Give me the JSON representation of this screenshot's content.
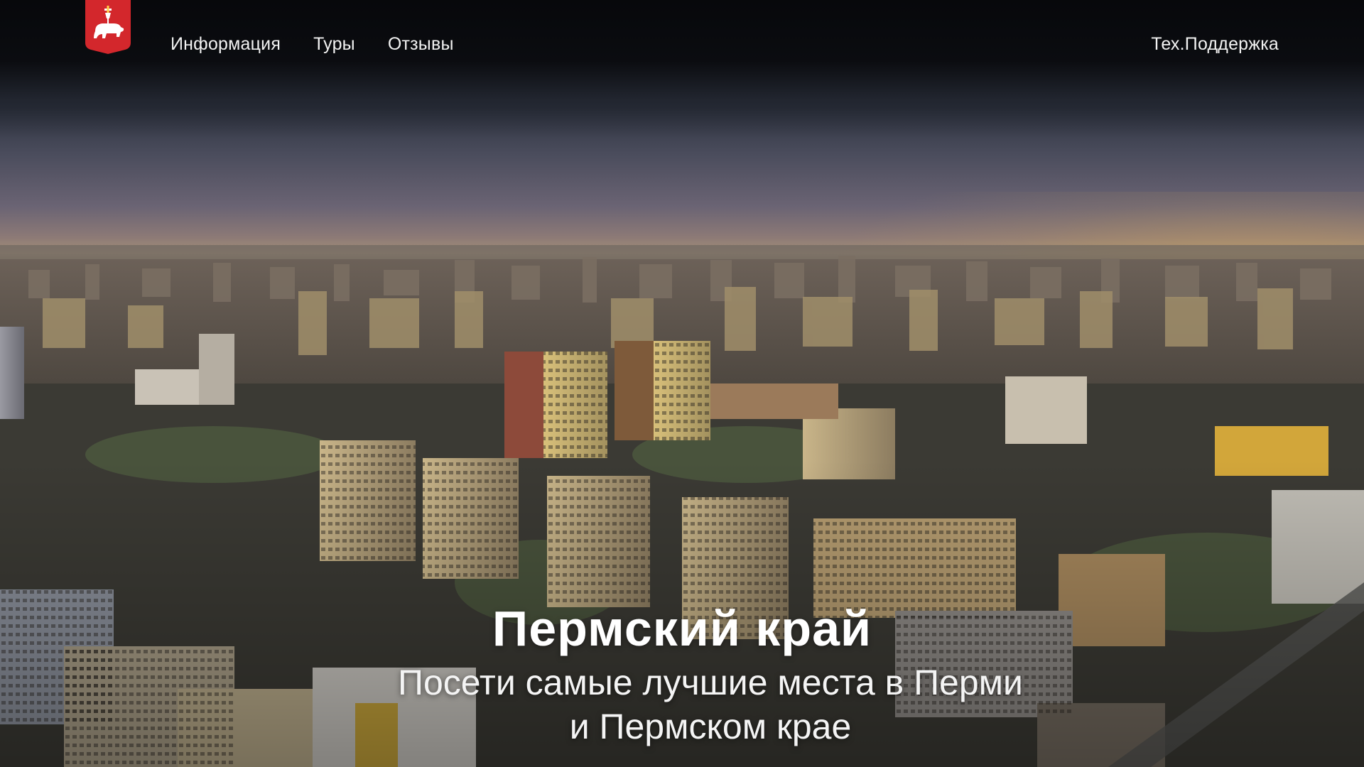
{
  "header": {
    "logo_name": "perm-bear-crest-icon",
    "nav": [
      {
        "label": "Информация"
      },
      {
        "label": "Туры"
      },
      {
        "label": "Отзывы"
      }
    ],
    "support_label": "Тех.Поддержка"
  },
  "hero": {
    "title": "Пермский край",
    "subtitle": "Посети самые лучшие места в Перми и Пермском крае"
  },
  "colors": {
    "logo_red": "#d3272c",
    "text": "#ffffff",
    "header_bg": "#07080b"
  }
}
